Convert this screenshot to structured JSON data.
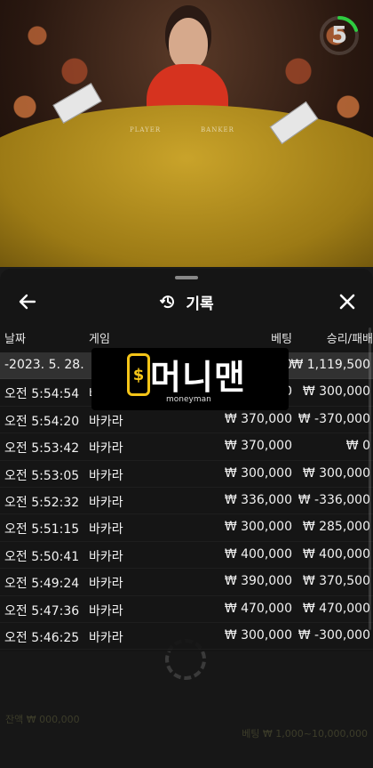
{
  "timer": {
    "value": "5",
    "progress": 0.2,
    "color": "#2ecc40"
  },
  "video": {
    "table_label_left": "PLAYER",
    "table_label_right": "BANKER"
  },
  "sheet": {
    "title": "기록",
    "title_icon": "history-icon",
    "back_icon": "arrow-left-icon",
    "close_icon": "close-icon",
    "columns": {
      "date": "날짜",
      "game": "게임",
      "bet": "베팅",
      "result": "승리/패배"
    },
    "rows": [
      {
        "time": "-2023. 5. 28.",
        "game": "",
        "bet": "₩ 300,000",
        "result": "₩ 1,119,500",
        "selected": true
      },
      {
        "time": "오전 5:54:54",
        "game": "바카라",
        "bet": "₩ 300,000",
        "result": "₩ 300,000"
      },
      {
        "time": "오전 5:54:20",
        "game": "바카라",
        "bet": "₩ 370,000",
        "result": "₩ -370,000"
      },
      {
        "time": "오전 5:53:42",
        "game": "바카라",
        "bet": "₩ 370,000",
        "result": "₩ 0"
      },
      {
        "time": "오전 5:53:05",
        "game": "바카라",
        "bet": "₩ 300,000",
        "result": "₩ 300,000"
      },
      {
        "time": "오전 5:52:32",
        "game": "바카라",
        "bet": "₩ 336,000",
        "result": "₩ -336,000"
      },
      {
        "time": "오전 5:51:15",
        "game": "바카라",
        "bet": "₩ 300,000",
        "result": "₩ 285,000"
      },
      {
        "time": "오전 5:50:41",
        "game": "바카라",
        "bet": "₩ 400,000",
        "result": "₩ 400,000"
      },
      {
        "time": "오전 5:49:24",
        "game": "바카라",
        "bet": "₩ 390,000",
        "result": "₩ 370,500"
      },
      {
        "time": "오전 5:47:36",
        "game": "바카라",
        "bet": "₩ 470,000",
        "result": "₩ 470,000"
      },
      {
        "time": "오전 5:46:25",
        "game": "바카라",
        "bet": "₩ 300,000",
        "result": "₩ -300,000"
      }
    ]
  },
  "watermark": {
    "coin_symbol": "$",
    "text": "머니맨",
    "sub": "moneyman",
    "accent": "#f5c518"
  },
  "background_footer": {
    "line1": "잔액 ₩ 000,000",
    "line2": "베팅 ₩ 1,000~10,000,000"
  }
}
